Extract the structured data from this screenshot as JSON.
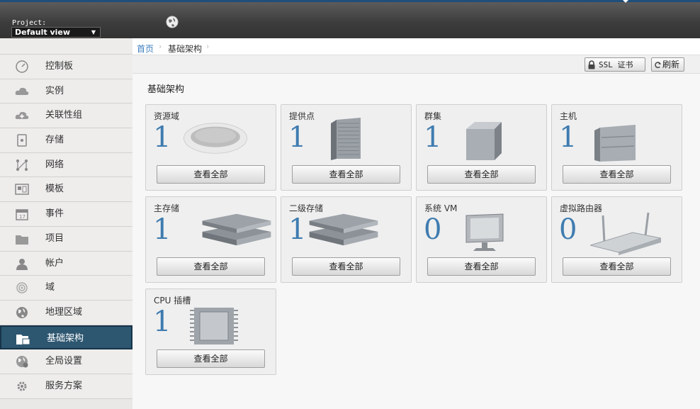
{
  "header": {
    "project_label": "Project:",
    "project_value": "Default view"
  },
  "breadcrumb": {
    "home": "首页",
    "current": "基础架构"
  },
  "toolbar": {
    "ssl_label": "SSL 证书",
    "refresh_label": "刷新"
  },
  "sidebar": {
    "items": [
      {
        "label": "控制板",
        "icon": "dashboard-icon"
      },
      {
        "label": "实例",
        "icon": "cloud-icon"
      },
      {
        "label": "关联性组",
        "icon": "affinity-icon"
      },
      {
        "label": "存储",
        "icon": "storage-icon"
      },
      {
        "label": "网络",
        "icon": "network-icon"
      },
      {
        "label": "模板",
        "icon": "template-icon"
      },
      {
        "label": "事件",
        "icon": "calendar-icon"
      },
      {
        "label": "项目",
        "icon": "folder-icon"
      },
      {
        "label": "帐户",
        "icon": "user-icon"
      },
      {
        "label": "域",
        "icon": "domain-icon"
      },
      {
        "label": "地理区域",
        "icon": "globe-icon"
      },
      {
        "label": "基础架构",
        "icon": "infrastructure-icon",
        "active": true
      },
      {
        "label": "全局设置",
        "icon": "global-settings-icon"
      },
      {
        "label": "服务方案",
        "icon": "gear-icon"
      }
    ]
  },
  "main": {
    "section_title": "基础架构",
    "cards": [
      {
        "title": "资源域",
        "count": "1",
        "button": "查看全部",
        "art": "zone"
      },
      {
        "title": "提供点",
        "count": "1",
        "button": "查看全部",
        "art": "pod"
      },
      {
        "title": "群集",
        "count": "1",
        "button": "查看全部",
        "art": "cluster"
      },
      {
        "title": "主机",
        "count": "1",
        "button": "查看全部",
        "art": "host"
      },
      {
        "title": "主存储",
        "count": "1",
        "button": "查看全部",
        "art": "primary-storage"
      },
      {
        "title": "二级存储",
        "count": "1",
        "button": "查看全部",
        "art": "secondary-storage"
      },
      {
        "title": "系统 VM",
        "count": "0",
        "button": "查看全部",
        "art": "system-vm"
      },
      {
        "title": "虚拟路由器",
        "count": "0",
        "button": "查看全部",
        "art": "virtual-router"
      },
      {
        "title": "CPU 插槽",
        "count": "1",
        "button": "查看全部",
        "art": "cpu-socket"
      }
    ]
  },
  "colors": {
    "accent": "#3f7cb0",
    "active_nav": "#2d5670"
  }
}
